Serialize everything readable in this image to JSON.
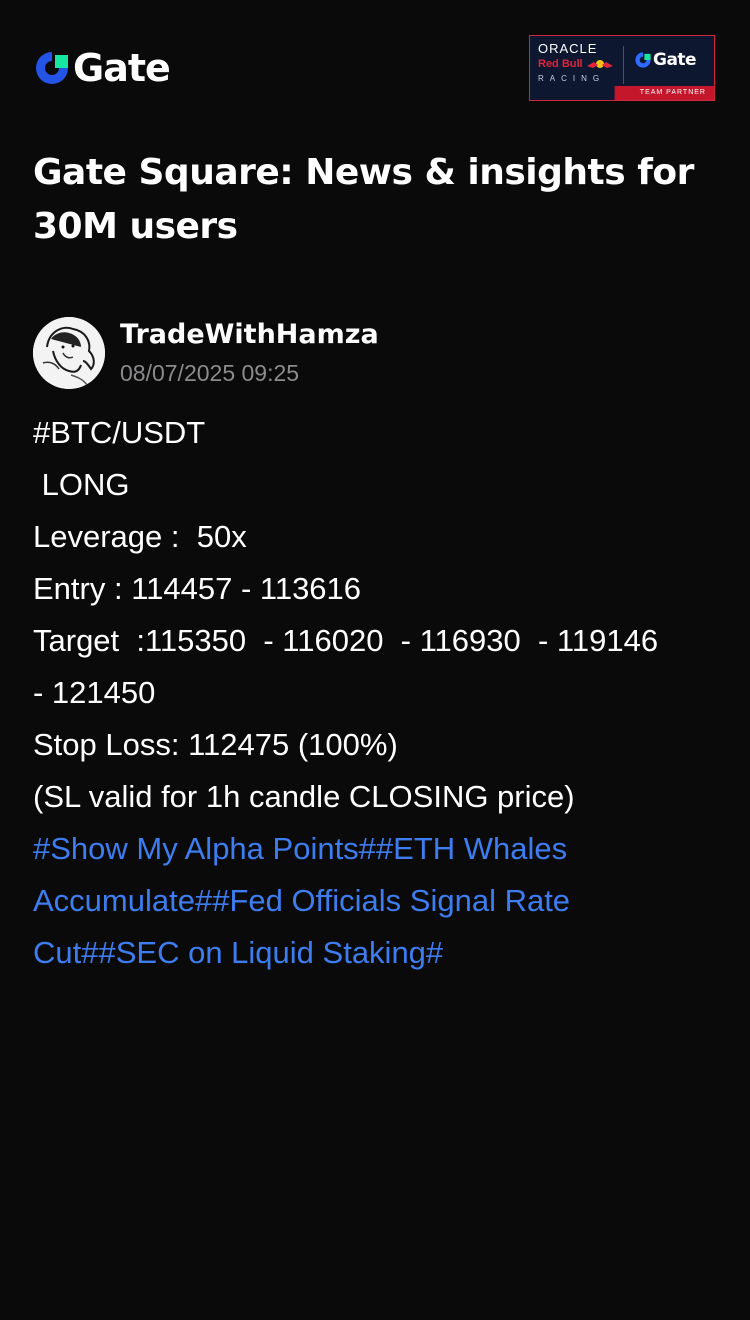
{
  "header": {
    "logo_text": "Gate",
    "partner": {
      "oracle": "ORACLE",
      "redbull": "Red Bull",
      "racing": "RACING",
      "gate": "Gate",
      "team_partner": "TEAM PARTNER"
    }
  },
  "page_title": "Gate Square: News & insights for 30M users",
  "post": {
    "author": "TradeWithHamza",
    "timestamp": "08/07/2025 09:25",
    "lines": [
      "#BTC/USDT",
      " LONG",
      "Leverage :  50x",
      "Entry : 114457 - 113616",
      "Target  :115350  - 116020  - 116930  - 119146",
      "- 121450",
      "Stop Loss: 112475 (100%)",
      "(SL valid for 1h candle CLOSING price)"
    ],
    "tags": [
      "#Show My Alpha Points#",
      "#ETH Whales Accumulate#",
      "#Fed Officials Signal Rate Cut#",
      "#SEC on Liquid Staking#"
    ]
  },
  "colors": {
    "background": "#0a0a0b",
    "text": "#ffffff",
    "muted": "#8b8b8e",
    "link": "#3d7df0",
    "brand_blue": "#2354e6",
    "brand_green": "#17e6a1",
    "partner_bg": "#0d1730",
    "partner_red": "#c4172c"
  },
  "icons": {
    "logo": "gate-logo-icon",
    "bull": "red-bull-icon",
    "avatar": "user-avatar"
  }
}
